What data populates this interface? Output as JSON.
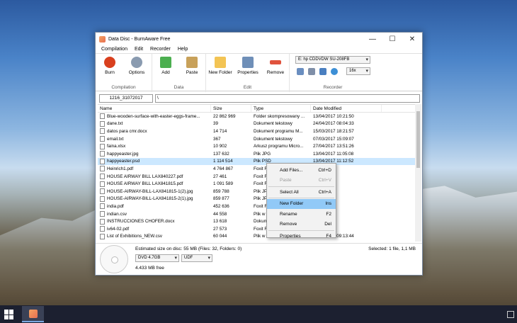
{
  "window": {
    "title": "Data Disc - BurnAware Free",
    "minimize": "—",
    "maximize": "☐",
    "close": "✕"
  },
  "menu": [
    "Compilation",
    "Edit",
    "Recorder",
    "Help"
  ],
  "ribbon": {
    "groups": {
      "compilation": "Compilation",
      "data": "Data",
      "edit": "Edit",
      "recorder": "Recorder"
    },
    "buttons": {
      "burn": "Burn",
      "options": "Options",
      "add": "Add",
      "paste": "Paste",
      "new_folder": "New Folder",
      "properties": "Properties",
      "remove": "Remove"
    },
    "drive": "E: hp CDDVDW SU-208FB",
    "speed": "16x",
    "colors": {
      "burn": "#d9401e",
      "options": "#8a9bb0",
      "add": "#4caf50",
      "paste": "#c8a15a",
      "new_folder": "#f3c454",
      "properties": "#6f8fb8",
      "remove": "#e0533d"
    }
  },
  "path": {
    "label": "1216_31072017",
    "value": "\\"
  },
  "columns": {
    "name": "Name",
    "size": "Size",
    "type": "Type",
    "date": "Date Modified"
  },
  "files": [
    {
      "name": "Blue-wooden-surface-with-easter-eggs-frame...",
      "size": "22 862 969",
      "type": "Folder skompresowany ...",
      "date": "13/04/2017 10:21:50"
    },
    {
      "name": "dane.txt",
      "size": "39",
      "type": "Dokument tekstowy",
      "date": "24/04/2017 08:04:33"
    },
    {
      "name": "datos para cmr.docx",
      "size": "14 714",
      "type": "Dokument programu M...",
      "date": "15/03/2017 18:21:57"
    },
    {
      "name": "email.txt",
      "size": "367",
      "type": "Dokument tekstowy",
      "date": "07/03/2017 15:09:07"
    },
    {
      "name": "faina.xlsx",
      "size": "10 902",
      "type": "Arkusz programu Micro...",
      "date": "27/04/2017 13:51:26"
    },
    {
      "name": "happyeaster.jpg",
      "size": "137 632",
      "type": "Plik JPG",
      "date": "13/04/2017 11:05:08"
    },
    {
      "name": "happyeaster.psd",
      "size": "1 114 514",
      "type": "Plik PSD",
      "date": "13/04/2017 11:12:52"
    },
    {
      "name": "Heinrich1.pdf",
      "size": "4 764 867",
      "type": "Foxit R",
      "date": "3:37:21"
    },
    {
      "name": "HOUSE AIRWAY BILL LAX840227.pdf",
      "size": "27 461",
      "type": "Foxit R",
      "date": "6:19:34"
    },
    {
      "name": "HOUSE AIRWAY BILL LAX841815.pdf",
      "size": "1 091 589",
      "type": "Foxit R",
      "date": "6:30:40"
    },
    {
      "name": "HOUSE-AIRWAY-BILL-LAX841815-1(2).jpg",
      "size": "859 788",
      "type": "Plik JP",
      "date": "6:51:16"
    },
    {
      "name": "HOUSE-AIRWAY-BILL-LAX841815-2(1).jpg",
      "size": "859 877",
      "type": "Plik JP",
      "date": "6:51:38"
    },
    {
      "name": "india.pdf",
      "size": "452 636",
      "type": "Foxit R",
      "date": "0:18:48"
    },
    {
      "name": "indian.csv",
      "size": "44 558",
      "type": "Plik w",
      "date": "0:44:52"
    },
    {
      "name": "INSTRUCCIONES CHOFER.docx",
      "size": "13 618",
      "type": "Dokum",
      "date": "0:23:39"
    },
    {
      "name": "iv64-02.pdf",
      "size": "27 573",
      "type": "Foxit R",
      "date": "0:48:51"
    },
    {
      "name": "List of Exhibitions_NEW.csv",
      "size": "60 044",
      "type": "Plik w formacie wartoś...",
      "date": "09/05/2017 09:13:44"
    }
  ],
  "context_menu": [
    {
      "label": "Add Files...",
      "shortcut": "Ctrl+D",
      "disabled": false
    },
    {
      "label": "Paste",
      "shortcut": "Ctrl+V",
      "disabled": true
    },
    {
      "label": "Select All",
      "shortcut": "Ctrl+A",
      "disabled": false
    },
    {
      "label": "New Folder",
      "shortcut": "Ins",
      "disabled": false
    },
    {
      "label": "Rename",
      "shortcut": "F2",
      "disabled": false
    },
    {
      "label": "Remove",
      "shortcut": "Del",
      "disabled": false
    },
    {
      "label": "Properties",
      "shortcut": "F4",
      "disabled": false
    }
  ],
  "status": {
    "estimated": "Estimated size on disc: 55 MB (Files: 32, Folders: 0)",
    "selected": "Selected: 1 file, 1,1 MB",
    "disc_type": "DVD 4.7GB",
    "filesystem": "UDF",
    "free": "4.433 MB free"
  }
}
